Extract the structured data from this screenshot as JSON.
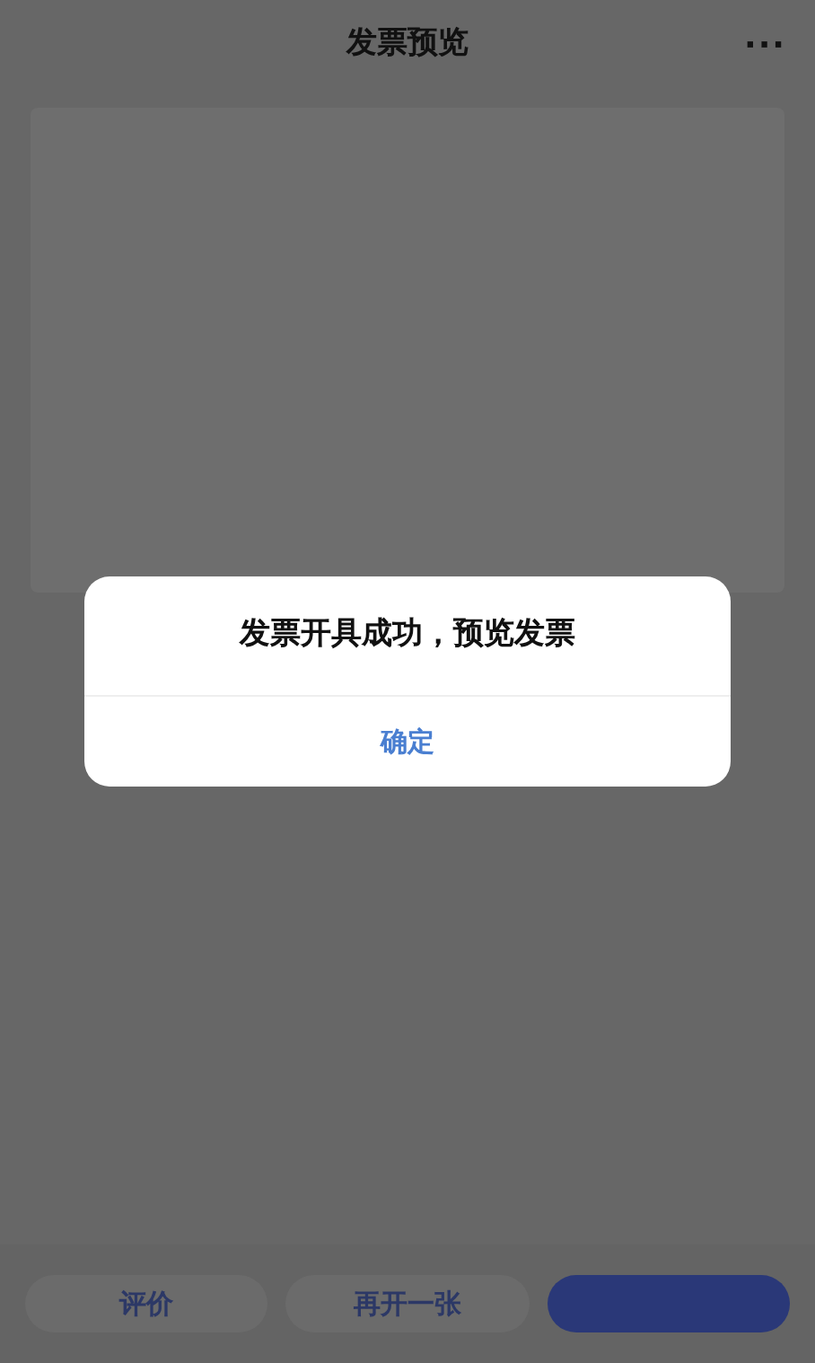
{
  "header": {
    "title": "发票预览",
    "menu": "···"
  },
  "dialog": {
    "message": "发票开具成功，预览发票",
    "confirm": "确定"
  },
  "bottom_bar": {
    "buttons": [
      {
        "label": "评价",
        "kind": "plain"
      },
      {
        "label": "再开一张",
        "kind": "plain"
      },
      {
        "kind": "primary"
      }
    ]
  }
}
